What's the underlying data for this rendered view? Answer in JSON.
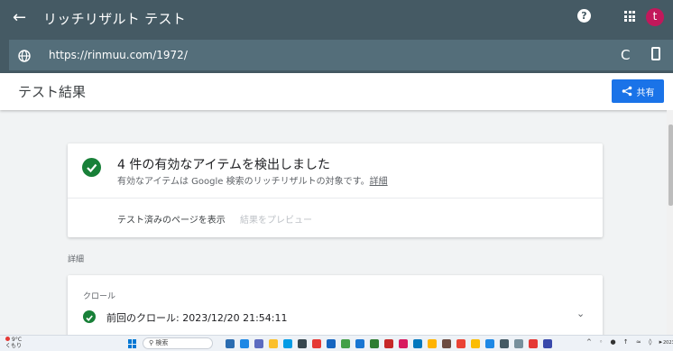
{
  "appbar": {
    "back_icon": "←",
    "title": "リッチリザルト テスト",
    "help_icon": "?",
    "avatar_letter": "t"
  },
  "urlbar": {
    "url": "https://rinmuu.com/1972/",
    "reload_icon": "C"
  },
  "header": {
    "title": "テスト結果",
    "share_label": "共有"
  },
  "summary": {
    "headline": "4 件の有効なアイテムを検出しました",
    "subtext": "有効なアイテムは Google 検索のリッチリザルトの対象です。",
    "details_link": "詳細",
    "view_tested_page": "テスト済みのページを表示",
    "preview_results": "結果をプレビュー"
  },
  "details_section": {
    "label": "詳細"
  },
  "crawl": {
    "label": "クロール",
    "last_crawl": "前回のクロール: 2023/12/20 21:54:11"
  },
  "taskbar": {
    "weather_temp": "9°C",
    "weather_sub": "くもり",
    "search_placeholder": "検索",
    "clock": "2023"
  },
  "colors": {
    "appbar": "#455a64",
    "url_field": "#546e7a",
    "share": "#1a73e8",
    "success": "#188038",
    "avatar": "#c2185b"
  }
}
